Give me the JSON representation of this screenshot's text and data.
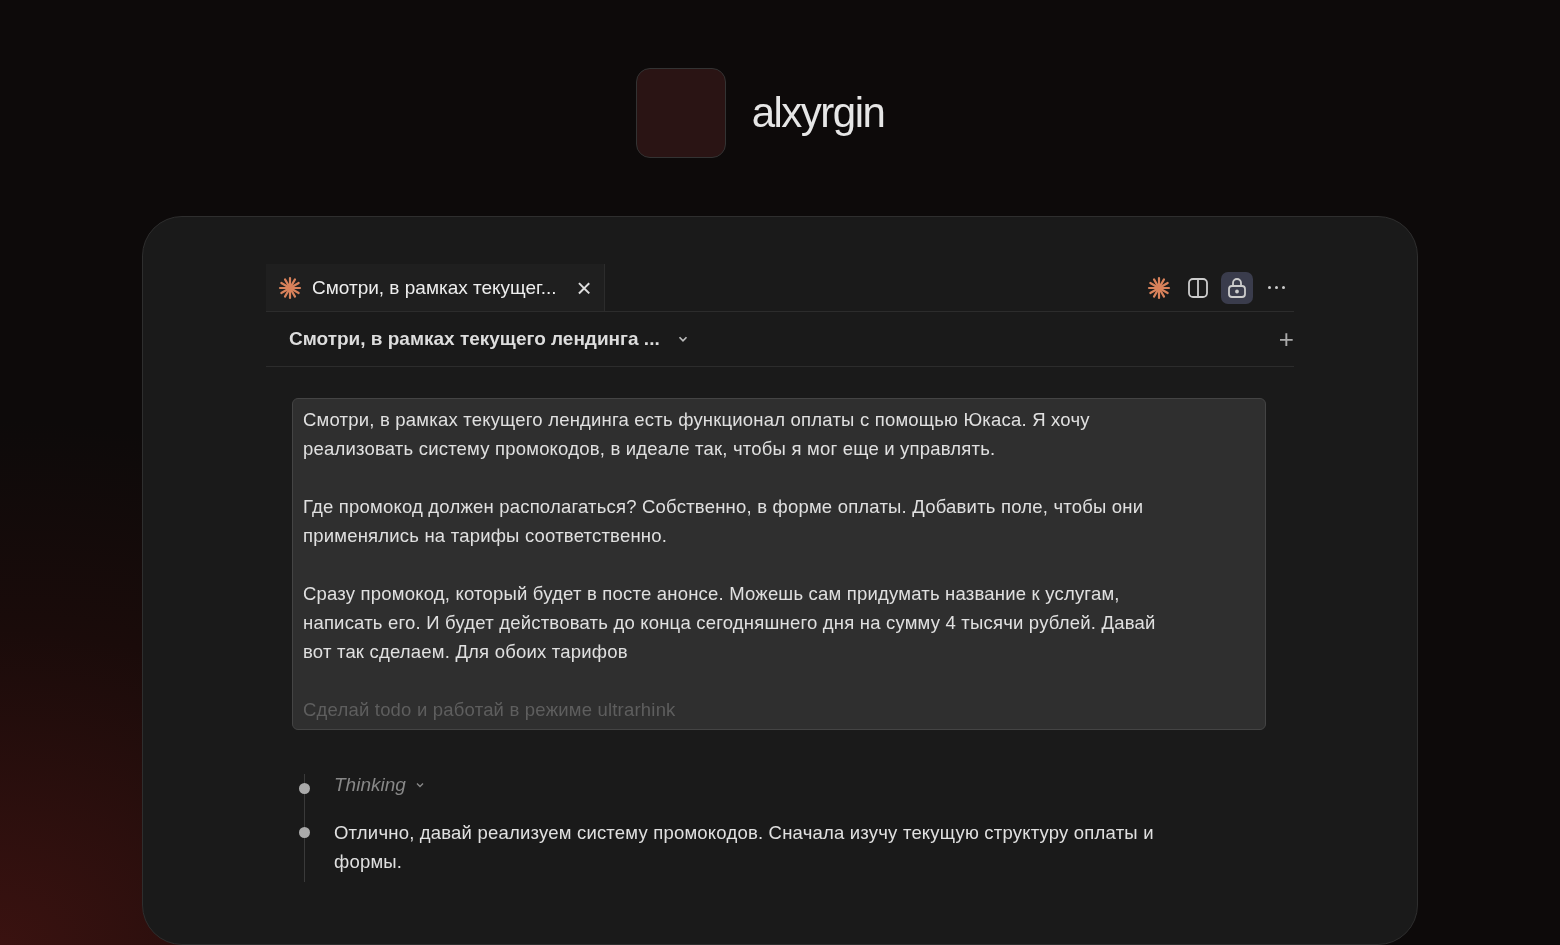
{
  "profile": {
    "name": "alxyrgin"
  },
  "tab": {
    "title": "Смотри, в рамках текущег...",
    "selected": true,
    "close": "×"
  },
  "toolbar": [
    {
      "kind": "spark",
      "selected": false
    },
    {
      "kind": "split",
      "selected": false
    },
    {
      "kind": "lock",
      "selected": true
    },
    {
      "kind": "more",
      "selected": false
    }
  ],
  "conversation": {
    "title": "Смотри, в рамках текущего лендинга ...",
    "add": "+"
  },
  "message": {
    "paragraphs": [
      {
        "text": "Смотри, в рамках текущего лендинга есть функционал оплаты с помощью Юкаса. Я хочу реализовать систему промокодов, в идеале так, чтобы я мог еще и управлять.",
        "faded": false
      },
      {
        "text": "Где промокод должен располагаться? Собственно, в форме оплаты. Добавить поле, чтобы они применялись на тарифы соответственно.",
        "faded": false
      },
      {
        "text": "Сразу промокод, который будет в посте анонсе. Можешь сам придумать название к услугам, написать его. И будет действовать до конца сегодняшнего дня на сумму 4 тысячи рублей. Давай вот так сделаем. Для обоих тарифов",
        "faded": false
      },
      {
        "text": "Сделай todo и работай в режиме ultrarhink",
        "faded": true
      }
    ]
  },
  "timeline": [
    {
      "kind": "thinking",
      "text": "Thinking",
      "expanded": false
    },
    {
      "kind": "reply",
      "text": "Отлично, давай реализуем систему промокодов. Сначала изучу текущую структуру оплаты и формы."
    }
  ]
}
